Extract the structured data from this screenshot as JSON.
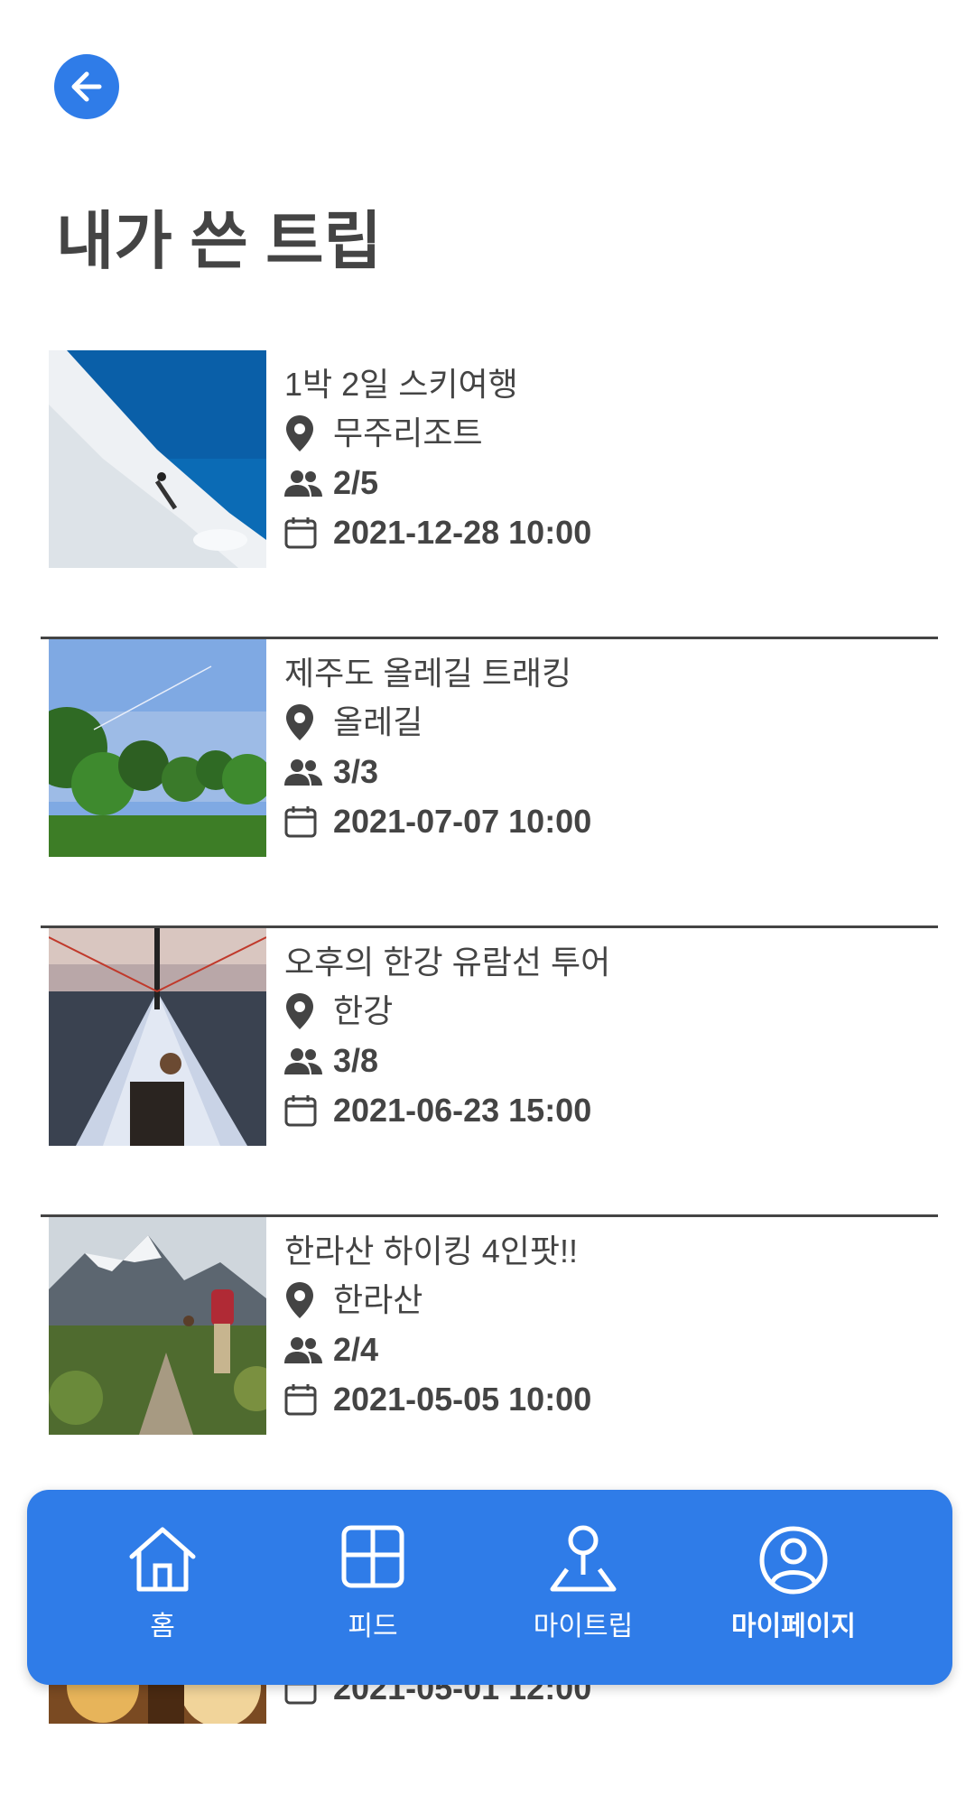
{
  "header": {
    "title": "내가 쓴 트립"
  },
  "trips": [
    {
      "title": "1박 2일 스키여행",
      "location": "무주리조트",
      "members": "2/5",
      "datetime": "2021-12-28 10:00"
    },
    {
      "title": "제주도 올레길 트래킹",
      "location": "올레길",
      "members": "3/3",
      "datetime": "2021-07-07 10:00"
    },
    {
      "title": "오후의 한강 유람선 투어",
      "location": "한강",
      "members": "3/8",
      "datetime": "2021-06-23 15:00"
    },
    {
      "title": "한라산 하이킹 4인팟!!",
      "location": "한라산",
      "members": "2/4",
      "datetime": "2021-05-05 10:00"
    },
    {
      "title": "",
      "location": "",
      "members": "",
      "datetime": "2021-05-01 12:00"
    }
  ],
  "nav": {
    "items": [
      {
        "label": "홈",
        "icon": "home-icon"
      },
      {
        "label": "피드",
        "icon": "feed-grid-icon"
      },
      {
        "label": "마이트립",
        "icon": "map-pin-icon"
      },
      {
        "label": "마이페이지",
        "icon": "user-circle-icon"
      }
    ],
    "active": "마이페이지"
  },
  "colors": {
    "accent": "#2f7ce8",
    "text": "#444444",
    "background": "#ffffff"
  }
}
